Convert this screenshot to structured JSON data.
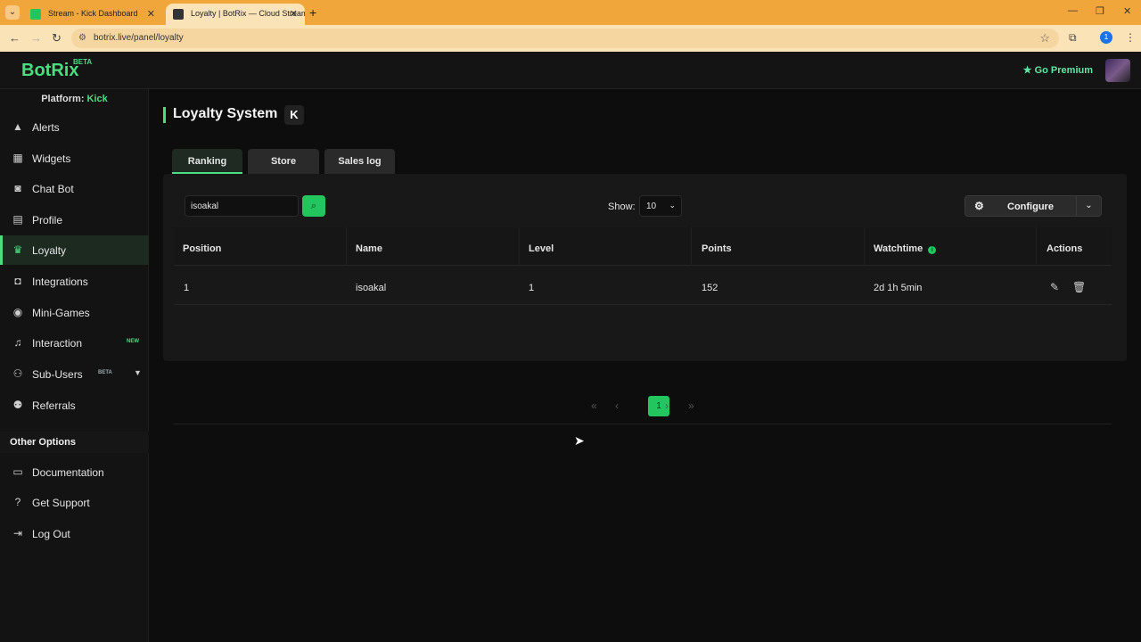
{
  "browser": {
    "tabs": [
      {
        "title": "Stream - Kick Dashboard",
        "favicon_color": "#22c55e"
      },
      {
        "title": "Loyalty | BotRix — Cloud Stream",
        "favicon_color": "#333333"
      }
    ],
    "url": "botrix.live/panel/loyalty",
    "profile_initial": "1"
  },
  "header": {
    "logo": "BotRix",
    "logo_badge": "BETA",
    "premium_label": "Go Premium"
  },
  "sidebar": {
    "platform_label": "Platform:",
    "platform_value": "Kick",
    "items": [
      {
        "label": "Alerts",
        "icon": "warning-icon"
      },
      {
        "label": "Widgets",
        "icon": "grid-icon"
      },
      {
        "label": "Chat Bot",
        "icon": "robot-icon"
      },
      {
        "label": "Profile",
        "icon": "id-card-icon"
      },
      {
        "label": "Loyalty",
        "icon": "trophy-icon"
      },
      {
        "label": "Integrations",
        "icon": "discord-icon"
      },
      {
        "label": "Mini-Games",
        "icon": "gamepad-icon"
      },
      {
        "label": "Interaction",
        "icon": "music-icon",
        "badge": "NEW"
      },
      {
        "label": "Sub-Users",
        "icon": "users-icon",
        "badge": "BETA"
      },
      {
        "label": "Referrals",
        "icon": "referral-icon"
      }
    ],
    "other_heading": "Other Options",
    "other_items": [
      {
        "label": "Documentation",
        "icon": "book-icon"
      },
      {
        "label": "Get Support",
        "icon": "question-icon"
      },
      {
        "label": "Log Out",
        "icon": "logout-icon"
      }
    ]
  },
  "page": {
    "title": "Loyalty System",
    "platform_glyph": "K",
    "tabs": [
      "Ranking",
      "Store",
      "Sales log"
    ],
    "active_tab": "Ranking"
  },
  "ranking": {
    "search_value": "isoakal",
    "show_label": "Show:",
    "show_value": "10",
    "configure_label": "Configure",
    "columns": [
      "Position",
      "Name",
      "Level",
      "Points",
      "Watchtime",
      "Actions"
    ],
    "rows": [
      {
        "position": "1",
        "name": "isoakal",
        "level": "1",
        "points": "152",
        "watchtime": "2d 1h 5min"
      }
    ],
    "pagination": {
      "current": "1"
    }
  },
  "colors": {
    "accent": "#22c55e",
    "tabbar": "#f1a63c"
  }
}
